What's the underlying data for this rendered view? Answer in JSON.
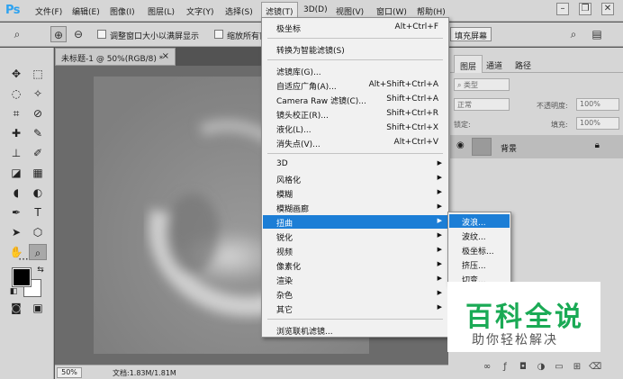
{
  "app": {
    "logo": "Ps"
  },
  "menubar": {
    "items": [
      "文件(F)",
      "编辑(E)",
      "图像(I)",
      "图层(L)",
      "文字(Y)",
      "选择(S)",
      "滤镜(T)",
      "3D(D)",
      "视图(V)",
      "窗口(W)",
      "帮助(H)"
    ],
    "active": "滤镜(T)"
  },
  "window_controls": {
    "minimize": "–",
    "restore": "❐",
    "close": "✕"
  },
  "options": {
    "resize_window": "调整窗口大小以满屏显示",
    "zoom_all": "缩放所有窗",
    "fill_screen": "填充屏幕"
  },
  "document": {
    "tab_title": "未标题-1 @ 50%(RGB/8) *",
    "zoom": "50%",
    "info": "文档:1.83M/1.81M"
  },
  "filter_menu": {
    "groups": [
      [
        {
          "label": "极坐标",
          "shortcut": "Alt+Ctrl+F"
        }
      ],
      [
        {
          "label": "转换为智能滤镜(S)"
        }
      ],
      [
        {
          "label": "滤镜库(G)..."
        },
        {
          "label": "自适应广角(A)...",
          "shortcut": "Alt+Shift+Ctrl+A"
        },
        {
          "label": "Camera Raw 滤镜(C)...",
          "shortcut": "Shift+Ctrl+A"
        },
        {
          "label": "镜头校正(R)...",
          "shortcut": "Shift+Ctrl+R"
        },
        {
          "label": "液化(L)...",
          "shortcut": "Shift+Ctrl+X"
        },
        {
          "label": "消失点(V)...",
          "shortcut": "Alt+Ctrl+V"
        }
      ],
      [
        {
          "label": "3D",
          "submenu": true
        },
        {
          "label": "风格化",
          "submenu": true
        },
        {
          "label": "模糊",
          "submenu": true
        },
        {
          "label": "模糊画廊",
          "submenu": true
        },
        {
          "label": "扭曲",
          "submenu": true,
          "highlighted": true
        },
        {
          "label": "锐化",
          "submenu": true
        },
        {
          "label": "视频",
          "submenu": true
        },
        {
          "label": "像素化",
          "submenu": true
        },
        {
          "label": "渲染",
          "submenu": true
        },
        {
          "label": "杂色",
          "submenu": true
        },
        {
          "label": "其它",
          "submenu": true
        }
      ],
      [
        {
          "label": "浏览联机滤镜..."
        }
      ]
    ]
  },
  "distort_submenu": {
    "items": [
      {
        "label": "波浪...",
        "highlighted": true
      },
      {
        "label": "波纹..."
      },
      {
        "label": "极坐标..."
      },
      {
        "label": "挤压..."
      },
      {
        "label": "切变..."
      }
    ]
  },
  "layers_panel": {
    "tabs": [
      "图层",
      "通道",
      "路径"
    ],
    "active_tab": "图层",
    "filter_kind": "类型",
    "blend_mode": "正常",
    "opacity_label": "不透明度:",
    "opacity_value": "100%",
    "lock_label": "锁定:",
    "fill_label": "填充:",
    "fill_value": "100%",
    "layers": [
      {
        "name": "背景",
        "locked": true
      }
    ]
  },
  "watermark": {
    "title": "百科全说",
    "subtitle": "助你轻松解决"
  },
  "colors": {
    "accent": "#1c7ed6",
    "watermark_green": "#1aaa55",
    "foreground": "#000000",
    "background": "#ffffff"
  }
}
